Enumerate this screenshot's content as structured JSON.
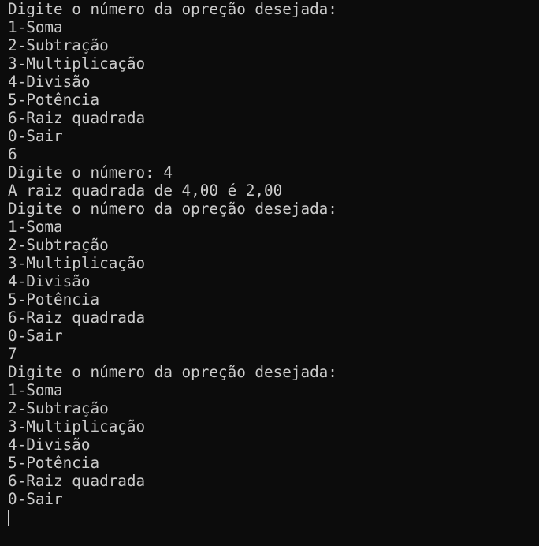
{
  "terminal": {
    "lines": [
      "Digite o número da opreção desejada:",
      "1-Soma",
      "2-Subtração",
      "3-Multiplicação",
      "4-Divisão",
      "5-Potência",
      "6-Raiz quadrada",
      "0-Sair",
      "6",
      "Digite o número: 4",
      "A raiz quadrada de 4,00 é 2,00",
      "Digite o número da opreção desejada:",
      "1-Soma",
      "2-Subtração",
      "3-Multiplicação",
      "4-Divisão",
      "5-Potência",
      "6-Raiz quadrada",
      "0-Sair",
      "7",
      "Digite o número da opreção desejada:",
      "1-Soma",
      "2-Subtração",
      "3-Multiplicação",
      "4-Divisão",
      "5-Potência",
      "6-Raiz quadrada",
      "0-Sair"
    ]
  },
  "colors": {
    "background": "#0c0c0c",
    "foreground": "#cccccc"
  }
}
